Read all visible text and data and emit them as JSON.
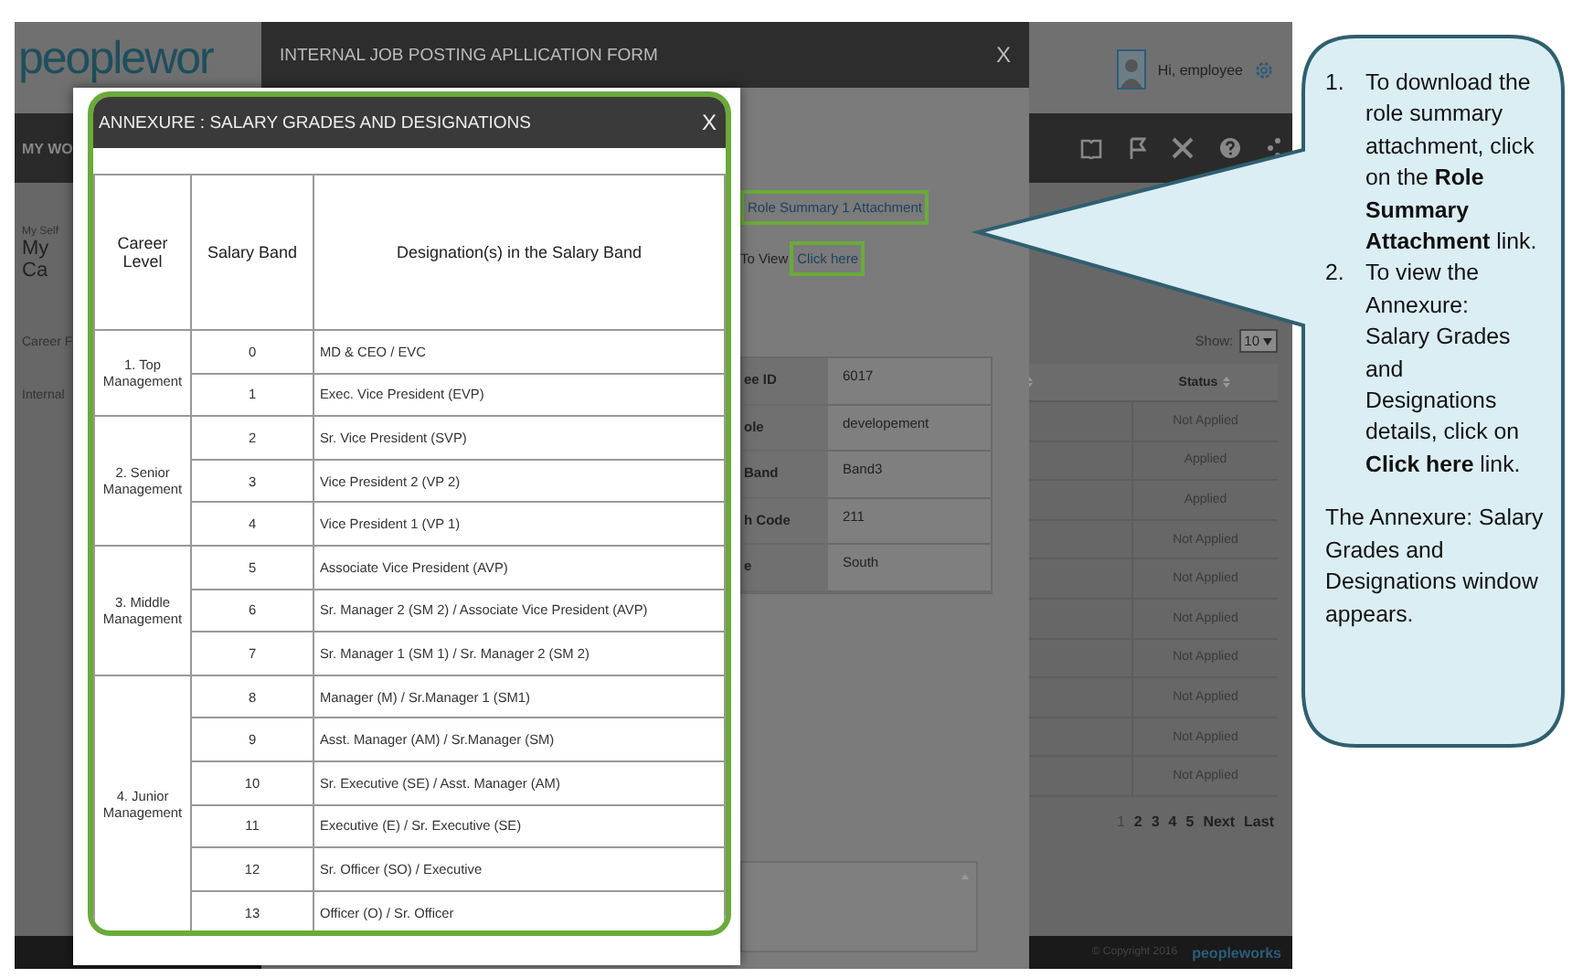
{
  "background_app": {
    "logo": "peoplewor",
    "user_greeting": "Hi, employee",
    "nav_label": "MY WO",
    "breadcrumb": "My Self",
    "page_title": "My Ca",
    "side_links": [
      "Career F",
      "Internal"
    ],
    "show_label": "Show:",
    "page_size": "10",
    "status_header": "Status",
    "statuses": [
      "Not Applied",
      "Applied",
      "Applied",
      "Not Applied",
      "Not Applied",
      "Not Applied",
      "Not Applied",
      "Not Applied",
      "Not Applied",
      "Not Applied"
    ],
    "pagination": [
      {
        "label": "1",
        "selected": true
      },
      {
        "label": "2",
        "selected": false
      },
      {
        "label": "3",
        "selected": false
      },
      {
        "label": "4",
        "selected": false
      },
      {
        "label": "5",
        "selected": false
      },
      {
        "label": "Next",
        "selected": false
      },
      {
        "label": "Last",
        "selected": false
      }
    ],
    "copyright": "© Copyright 2016",
    "footer_logo": "peopleworks"
  },
  "application_form": {
    "title": "INTERNAL JOB POSTING APLLICATION FORM",
    "close": "X",
    "attachment_link": "Role Summary 1 Attachment",
    "view_label": "To View",
    "view_link": "Click here",
    "details": [
      {
        "label": "ee ID",
        "value": "6017"
      },
      {
        "label": "ole",
        "value": "developement"
      },
      {
        "label": "Band",
        "value": "Band3"
      },
      {
        "label": "h Code",
        "value": "211"
      },
      {
        "label": "e",
        "value": "South"
      }
    ]
  },
  "annexure": {
    "title": "ANNEXURE : SALARY GRADES AND DESIGNATIONS",
    "close": "X",
    "columns": [
      "Career Level",
      "Salary Band",
      "Designation(s) in the Salary Band"
    ],
    "groups": [
      {
        "level": "1. Top Management",
        "bands": [
          {
            "band": "0",
            "designation": "MD & CEO / EVC"
          },
          {
            "band": "1",
            "designation": "Exec. Vice President (EVP)"
          }
        ]
      },
      {
        "level": "2. Senior Management",
        "bands": [
          {
            "band": "2",
            "designation": "Sr. Vice President (SVP)"
          },
          {
            "band": "3",
            "designation": "Vice President 2 (VP 2)"
          },
          {
            "band": "4",
            "designation": "Vice President 1 (VP 1)"
          }
        ]
      },
      {
        "level": "3. Middle Management",
        "bands": [
          {
            "band": "5",
            "designation": "Associate Vice President (AVP)"
          },
          {
            "band": "6",
            "designation": "Sr. Manager 2 (SM 2) / Associate Vice President (AVP)"
          },
          {
            "band": "7",
            "designation": "Sr. Manager 1 (SM 1) / Sr. Manager 2 (SM 2)"
          }
        ]
      },
      {
        "level": "4. Junior Management",
        "bands": [
          {
            "band": "8",
            "designation": "Manager (M) / Sr.Manager 1 (SM1)"
          },
          {
            "band": "9",
            "designation": "Asst. Manager (AM) / Sr.Manager (SM)"
          },
          {
            "band": "10",
            "designation": "Sr. Executive (SE) / Asst. Manager (AM)"
          },
          {
            "band": "11",
            "designation": "Executive (E) / Sr. Executive (SE)"
          },
          {
            "band": "12",
            "designation": "Sr. Officer (SO) / Executive"
          },
          {
            "band": "13",
            "designation": "Officer (O) / Sr. Officer"
          }
        ]
      }
    ]
  },
  "callout": {
    "steps": [
      {
        "number": "1.",
        "text": "To download the role summary attachment, click on the **Role Summary Attachment** link."
      },
      {
        "number": "2.",
        "text": "To view the Annexure: Salary Grades and Designations details, click on **Click here** link."
      }
    ],
    "note": "The Annexure: Salary Grades and Designations window appears."
  }
}
